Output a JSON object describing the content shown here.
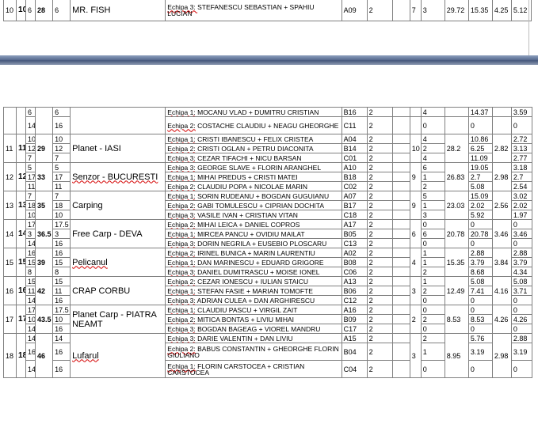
{
  "top_row": {
    "cells": [
      "10",
      "10",
      "6",
      "28",
      "6",
      "MR. FISH"
    ],
    "team_prefix": "Echipa 3: ",
    "team_names": "STEFANESCU SEBASTIAN + SPAHIU LUCIAN",
    "sector": "A09",
    "c1": "2",
    "c2": "",
    "c3": "7",
    "c4": "3",
    "v1": "29.72",
    "v2": "15.35",
    "v3": "4.25",
    "v4": "5.12"
  },
  "groups": [
    {
      "no": "",
      "place": "",
      "total": "",
      "name": "",
      "rows": [
        {
          "a": "6",
          "b": "6",
          "team": "Echipa 1:",
          "names": "MOCANU VLAD + DUMITRU CRISTIAN",
          "sector": "B16",
          "p": "2",
          "s": "",
          "r": "4",
          "v1": "",
          "v2": "14.37",
          "v3": "",
          "v4": "3.59"
        },
        {
          "a": "14",
          "b": "16",
          "team": "Echipa 2:",
          "names": "COSTACHE CLAUDIU + NEAGU GHEORGHE",
          "sector": "C11",
          "p": "2",
          "s": "",
          "r": "0",
          "v1": "",
          "v2": "0",
          "v3": "",
          "v4": "0"
        }
      ]
    },
    {
      "no": "11",
      "place": "11",
      "total": "29",
      "name": "Planet - IASI",
      "rank": "10",
      "weight": "28.2",
      "avg": "2.82",
      "rows": [
        {
          "a": "10",
          "b": "10",
          "team": "Echipa 1:",
          "names": "CRISTI IBANESCU + FELIX CRISTEA",
          "sector": "A04",
          "p": "2",
          "r": "4",
          "v2": "10.86",
          "v4": "2.72"
        },
        {
          "a": "12",
          "b": "12",
          "team": "Echipa 2:",
          "names": "CRISTI OGLAN + PETRU DIACONITA",
          "sector": "B14",
          "p": "2",
          "r": "2",
          "v2": "6.25",
          "v4": "3.13"
        },
        {
          "a": "7",
          "b": "7",
          "team": "Echipa 3:",
          "names": "CEZAR TIFACHI + NICU BARSAN",
          "sector": "C01",
          "p": "2",
          "r": "4",
          "v2": "11.09",
          "v4": "2.77"
        }
      ]
    },
    {
      "no": "12",
      "place": "12",
      "total": "33",
      "name": "Senzor - BUCURESTI",
      "rank": "9",
      "weight": "26.83",
      "avg": "2.98",
      "rows": [
        {
          "a": "5",
          "b": "5",
          "team": "Echipa 3:",
          "names": "GEORGE SLAVE + FLORIN ARANGHEL",
          "sector": "A10",
          "p": "2",
          "r": "6",
          "v2": "19.05",
          "v4": "3.18"
        },
        {
          "a": "17",
          "b": "17",
          "team": "Echipa 1:",
          "names": "MIHAI PREDUS + CRISTI MATEI",
          "sector": "B18",
          "p": "2",
          "r": "1",
          "v2": "2.7",
          "v4": "2.7"
        },
        {
          "a": "11",
          "b": "11",
          "team": "Echipa 2:",
          "names": "CLAUDIU POPA + NICOLAE MARIN",
          "sector": "C02",
          "p": "2",
          "r": "2",
          "v2": "5.08",
          "v4": "2.54"
        }
      ]
    },
    {
      "no": "13",
      "place": "13",
      "total": "35",
      "name": "Carping",
      "rank": "9",
      "weight": "23.03",
      "avg": "2.56",
      "rows": [
        {
          "a": "7",
          "b": "7",
          "team": "Echipa 1:",
          "names": "SORIN RUDEANU + BOGDAN GUGUIANU",
          "sector": "A07",
          "p": "2",
          "r": "5",
          "v2": "15.09",
          "v4": "3.02"
        },
        {
          "a": "18",
          "b": "18",
          "team": "Echipa 2:",
          "names": "GABI TOMULESCU + CIPRIAN DOCHITA",
          "sector": "B17",
          "p": "2",
          "r": "1",
          "v2": "2.02",
          "v4": "2.02"
        },
        {
          "a": "10",
          "b": "10",
          "team": "Echipa 3:",
          "names": "VASILE IVAN + CRISTIAN VITAN",
          "sector": "C18",
          "p": "2",
          "r": "3",
          "v2": "5.92",
          "v4": "1.97"
        }
      ]
    },
    {
      "no": "14",
      "place": "14",
      "total": "36.5",
      "name": "Free Carp - DEVA",
      "rank": "6",
      "weight": "20.78",
      "avg": "3.46",
      "rows": [
        {
          "a": "17",
          "b": "17.5",
          "team": "Echipa 2:",
          "names": "MIHAI LEICA + DANIEL COPROS",
          "sector": "A17",
          "p": "2",
          "r": "0",
          "v2": "0",
          "v4": "0"
        },
        {
          "a": "3",
          "b": "3",
          "team": "Echipa 1:",
          "names": "MIRCEA PANCU + OVIDIU MAILAT",
          "sector": "B05",
          "p": "2",
          "r": "6",
          "v2": "20.78",
          "v4": "3.46"
        },
        {
          "a": "14",
          "b": "16",
          "team": "Echipa 3:",
          "names": "DORIN NEGRILA + EUSEBIO PLOSCARU",
          "sector": "C13",
          "p": "2",
          "r": "0",
          "v2": "0",
          "v4": "0"
        }
      ]
    },
    {
      "no": "15",
      "place": "15",
      "total": "39",
      "name": "Pelicanul",
      "rank": "4",
      "weight": "15.35",
      "avg": "3.84",
      "rows": [
        {
          "a": "16",
          "b": "16",
          "team": "Echipa 2:",
          "names": "IRINEL BUNICA + MARIN LAURENTIU",
          "sector": "A02",
          "p": "2",
          "r": "1",
          "v2": "2.88",
          "v4": "2.88"
        },
        {
          "a": "15",
          "b": "15",
          "team": "Echipa 1:",
          "names": "DAN MARINESCU + EDUARD GRIGORE",
          "sector": "B08",
          "p": "2",
          "r": "1",
          "v2": "3.79",
          "v4": "3.79"
        },
        {
          "a": "8",
          "b": "8",
          "team": "Echipa 3:",
          "names": "DANIEL DUMITRASCU + MOISE IONEL",
          "sector": "C06",
          "p": "2",
          "r": "2",
          "v2": "8.68",
          "v4": "4.34"
        }
      ]
    },
    {
      "no": "16",
      "place": "16",
      "total": "42",
      "name": "CRAP CORBU",
      "rank": "3",
      "weight": "12.49",
      "avg": "4.16",
      "rows": [
        {
          "a": "15",
          "b": "15",
          "team": "Echipa 2:",
          "names": "CEZAR IONESCU + IULIAN STAICU",
          "sector": "A13",
          "p": "2",
          "r": "1",
          "v2": "5.08",
          "v4": "5.08"
        },
        {
          "a": "11",
          "b": "11",
          "team": "Echipa 1:",
          "names": "STEFAN FASIE + MARIAN TOMOFTE",
          "sector": "B06",
          "p": "2",
          "r": "2",
          "v2": "7.41",
          "v4": "3.71"
        },
        {
          "a": "14",
          "b": "16",
          "team": "Echipa 3:",
          "names": "ADRIAN CULEA + DAN ARGHIRESCU",
          "sector": "C12",
          "p": "2",
          "r": "0",
          "v2": "0",
          "v4": "0"
        }
      ]
    },
    {
      "no": "17",
      "place": "17",
      "total": "43.5",
      "name": "Planet Carp - PIATRA NEAMT",
      "rank": "2",
      "weight": "8.53",
      "avg": "4.26",
      "rows": [
        {
          "a": "17",
          "b": "17.5",
          "team": "Echipa 1:",
          "names": "CLAUDIU PASCU + VIRGIL ZAIT",
          "sector": "A16",
          "p": "2",
          "r": "0",
          "v2": "0",
          "v4": "0"
        },
        {
          "a": "10",
          "b": "10",
          "team": "Echipa 2:",
          "names": "MITICA BONTAS + LIVIU MIHAI",
          "sector": "B09",
          "p": "2",
          "r": "2",
          "v2": "8.53",
          "v4": "4.26"
        },
        {
          "a": "14",
          "b": "16",
          "team": "Echipa 3:",
          "names": "BOGDAN BAGEAG + VIOREL MANDRU",
          "sector": "C17",
          "p": "2",
          "r": "0",
          "v2": "0",
          "v4": "0"
        }
      ]
    },
    {
      "no": "18",
      "place": "18",
      "total": "46",
      "name": "Lufarul",
      "rank": "3",
      "weight": "8.95",
      "avg": "2.98",
      "rows": [
        {
          "a": "14",
          "b": "14",
          "team": "Echipa 3:",
          "names": "DARIE VALENTIN + DAN LIVIU",
          "sector": "A15",
          "p": "2",
          "r": "2",
          "v2": "5.76",
          "v4": "2.88"
        },
        {
          "a": "16",
          "b": "16",
          "team": "Echipa 2:",
          "names": "BABUS CONSTANTIN + GHEORGHE FLORIN GIULIANO",
          "sector": "B04",
          "p": "2",
          "r": "1",
          "v2": "3.19",
          "v4": "3.19"
        },
        {
          "a": "14",
          "b": "16",
          "team": "Echipa 1:",
          "names": "FLORIN CARSTOCEA + CRISTIAN CARSTOCEA",
          "sector": "C04",
          "p": "2",
          "r": "0",
          "v2": "0",
          "v4": "0"
        }
      ]
    }
  ]
}
